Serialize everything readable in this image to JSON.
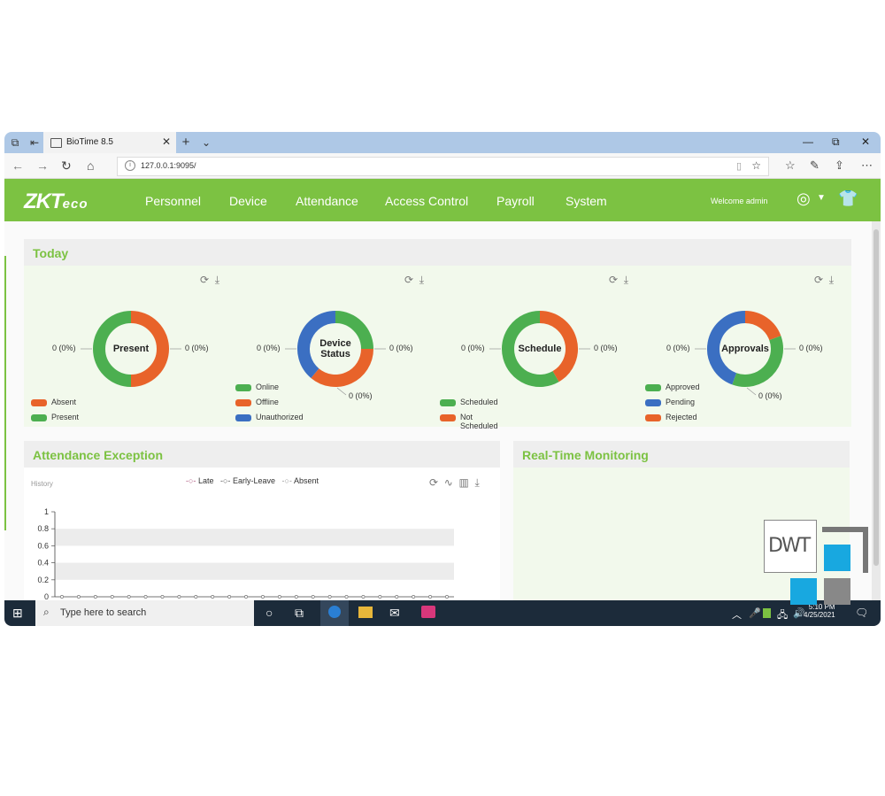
{
  "browser": {
    "tab_title": "BioTime 8.5",
    "url": "127.0.0.1:9095/"
  },
  "app": {
    "logo_main": "ZKT",
    "logo_sub": "eco",
    "menu": [
      "Personnel",
      "Device",
      "Attendance",
      "Access Control",
      "Payroll",
      "System"
    ],
    "welcome": "Welcome admin"
  },
  "today": {
    "title": "Today",
    "charts": [
      {
        "label": "Present",
        "left_value": "0 (0%)",
        "right_value": "0 (0%)",
        "legend": [
          {
            "name": "Absent",
            "color": "#e8632a"
          },
          {
            "name": "Present",
            "color": "#4caf50"
          }
        ]
      },
      {
        "label": "Device Status",
        "label_line1": "Device",
        "label_line2": "Status",
        "left_value": "0 (0%)",
        "right_value": "0 (0%)",
        "bottom_value": "0 (0%)",
        "legend": [
          {
            "name": "Online",
            "color": "#4caf50"
          },
          {
            "name": "Offline",
            "color": "#e8632a"
          },
          {
            "name": "Unauthorized",
            "color": "#3b6fc2"
          }
        ]
      },
      {
        "label": "Schedule",
        "left_value": "0 (0%)",
        "right_value": "0 (0%)",
        "legend": [
          {
            "name": "Scheduled",
            "color": "#4caf50"
          },
          {
            "name": "Not Scheduled",
            "color": "#e8632a"
          }
        ]
      },
      {
        "label": "Approvals",
        "left_value": "0 (0%)",
        "right_value": "0 (0%)",
        "bottom_value": "0 (0%)",
        "legend": [
          {
            "name": "Approved",
            "color": "#4caf50"
          },
          {
            "name": "Pending",
            "color": "#3b6fc2"
          },
          {
            "name": "Rejected",
            "color": "#e8632a"
          }
        ]
      }
    ]
  },
  "exception": {
    "title": "Attendance Exception",
    "history": "History",
    "series_labels": [
      "Late",
      "Early-Leave",
      "Absent"
    ]
  },
  "chart_data": {
    "type": "line",
    "series": [
      {
        "name": "Late",
        "values": []
      },
      {
        "name": "Early-Leave",
        "values": []
      },
      {
        "name": "Absent",
        "values": []
      }
    ],
    "yticks": [
      "1",
      "0.8",
      "0.6",
      "0.4",
      "0.2",
      "0"
    ],
    "ylim": [
      0,
      1
    ]
  },
  "realtime": {
    "title": "Real-Time Monitoring"
  },
  "taskbar": {
    "search_placeholder": "Type here to search",
    "time": "5:10 PM",
    "date": "4/25/2021"
  },
  "watermark": "DWT"
}
